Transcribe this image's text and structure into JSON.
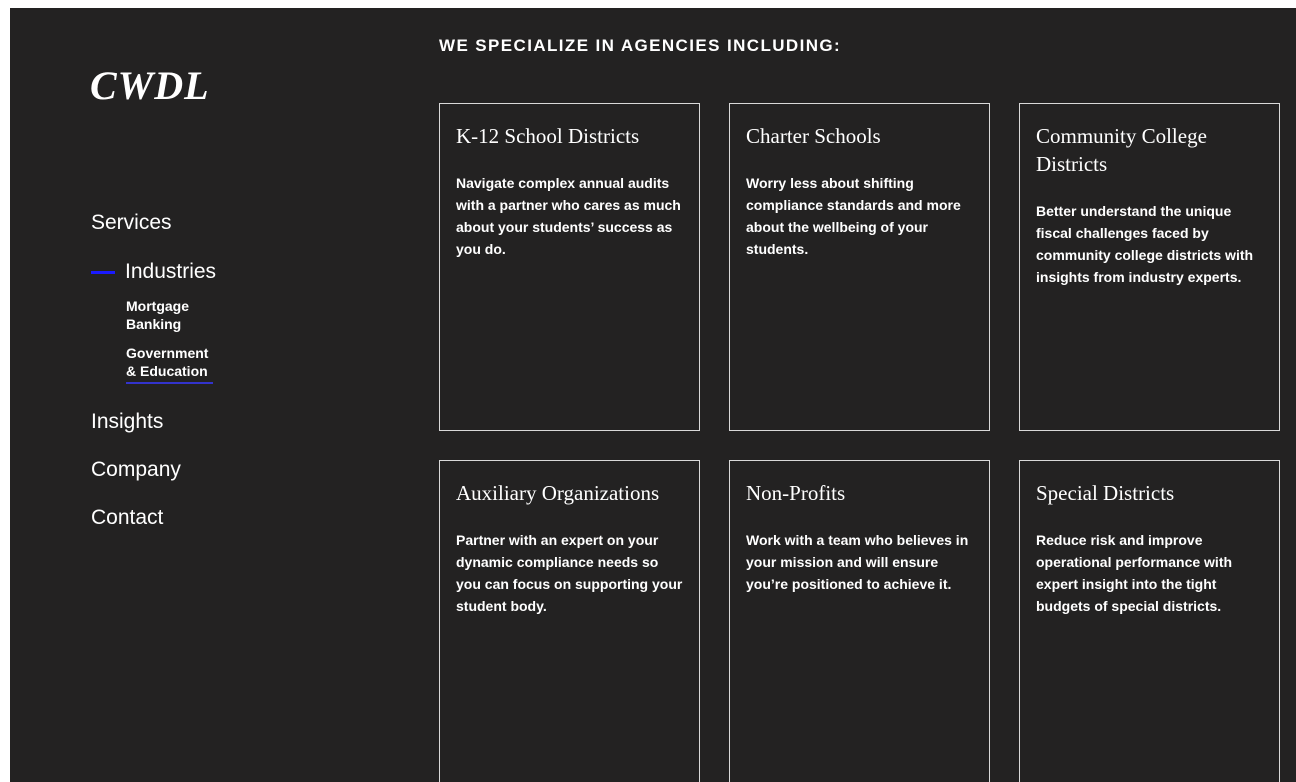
{
  "brand": {
    "logo": "CWDL"
  },
  "nav": {
    "services": "Services",
    "industries": "Industries",
    "sub": [
      {
        "label": "Mortgage Banking"
      },
      {
        "label": "Government & Education"
      }
    ],
    "insights": "Insights",
    "company": "Company",
    "contact": "Contact"
  },
  "main": {
    "heading": "WE SPECIALIZE IN AGENCIES INCLUDING:",
    "cards": [
      {
        "title": "K-12 School Districts",
        "desc": "Navigate complex annual audits with a partner who cares as much about your students’ success as you do."
      },
      {
        "title": "Charter Schools",
        "desc": "Worry less about shifting compliance standards and more about the wellbeing of your students."
      },
      {
        "title": "Community College Districts",
        "desc": "Better understand the unique fiscal challenges faced by community college districts with insights from industry experts."
      },
      {
        "title": "Auxiliary Organizations",
        "desc": "Partner with an expert on your dynamic compliance needs so you can focus on supporting your student body."
      },
      {
        "title": "Non-Profits",
        "desc": "Work with a team who believes in your mission and will ensure you’re positioned to achieve it."
      },
      {
        "title": "Special Districts",
        "desc": "Reduce risk and improve operational performance with expert insight into the tight budgets of special districts."
      }
    ]
  },
  "colors": {
    "background": "#232222",
    "accent": "#1a1aff",
    "text": "#ffffff",
    "border": "#d9d9d9"
  }
}
